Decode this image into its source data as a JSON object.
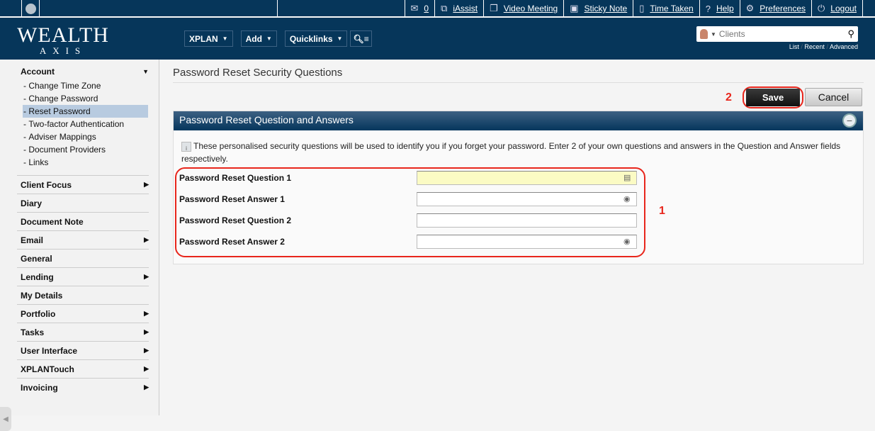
{
  "topbar": {
    "links": [
      {
        "icon": "mail-icon",
        "label": "0"
      },
      {
        "icon": "iassist-icon",
        "label": "iAssist"
      },
      {
        "icon": "video-meeting-icon",
        "label": "Video Meeting"
      },
      {
        "icon": "sticky-note-icon",
        "label": "Sticky Note"
      },
      {
        "icon": "timer-icon",
        "label": "Time Taken"
      },
      {
        "icon": "help-icon",
        "label": "Help"
      },
      {
        "icon": "gear-icon",
        "label": "Preferences"
      },
      {
        "icon": "power-icon",
        "label": "Logout"
      }
    ]
  },
  "header": {
    "logo": {
      "line1": "WEALTH",
      "line2": "AXIS"
    },
    "nav": [
      {
        "label": "XPLAN"
      },
      {
        "label": "Add"
      },
      {
        "label": "Quicklinks"
      }
    ],
    "search": {
      "placeholder": "Clients",
      "links": [
        "List",
        "Recent",
        "Advanced"
      ]
    }
  },
  "sidebar": {
    "account": {
      "label": "Account",
      "items": [
        "Change Time Zone",
        "Change Password",
        "Reset Password",
        "Two-factor Authentication",
        "Adviser Mappings",
        "Document Providers",
        "Links"
      ],
      "active": "Reset Password"
    },
    "sections": [
      {
        "label": "Client Focus",
        "arrow": true
      },
      {
        "label": "Diary",
        "arrow": false
      },
      {
        "label": "Document Note",
        "arrow": false
      },
      {
        "label": "Email",
        "arrow": true
      },
      {
        "label": "General",
        "arrow": false
      },
      {
        "label": "Lending",
        "arrow": true
      },
      {
        "label": "My Details",
        "arrow": false
      },
      {
        "label": "Portfolio",
        "arrow": true
      },
      {
        "label": "Tasks",
        "arrow": true
      },
      {
        "label": "User Interface",
        "arrow": true
      },
      {
        "label": "XPLANTouch",
        "arrow": true
      },
      {
        "label": "Invoicing",
        "arrow": true
      }
    ]
  },
  "main": {
    "title": "Password Reset Security Questions",
    "save_label": "Save",
    "cancel_label": "Cancel",
    "panel_title": "Password Reset Question and Answers",
    "info": "These personalised security questions will be used to identify you if you forget your password. Enter 2 of your own questions and answers in the Question and Answer fields respectively.",
    "fields": [
      {
        "label": "Password Reset Question 1",
        "value": ""
      },
      {
        "label": "Password Reset Answer 1",
        "value": ""
      },
      {
        "label": "Password Reset Question 2",
        "value": ""
      },
      {
        "label": "Password Reset Answer 2",
        "value": ""
      }
    ],
    "annotations": {
      "fields_marker": "1",
      "save_marker": "2"
    },
    "annotation_color": "#e8261c"
  }
}
